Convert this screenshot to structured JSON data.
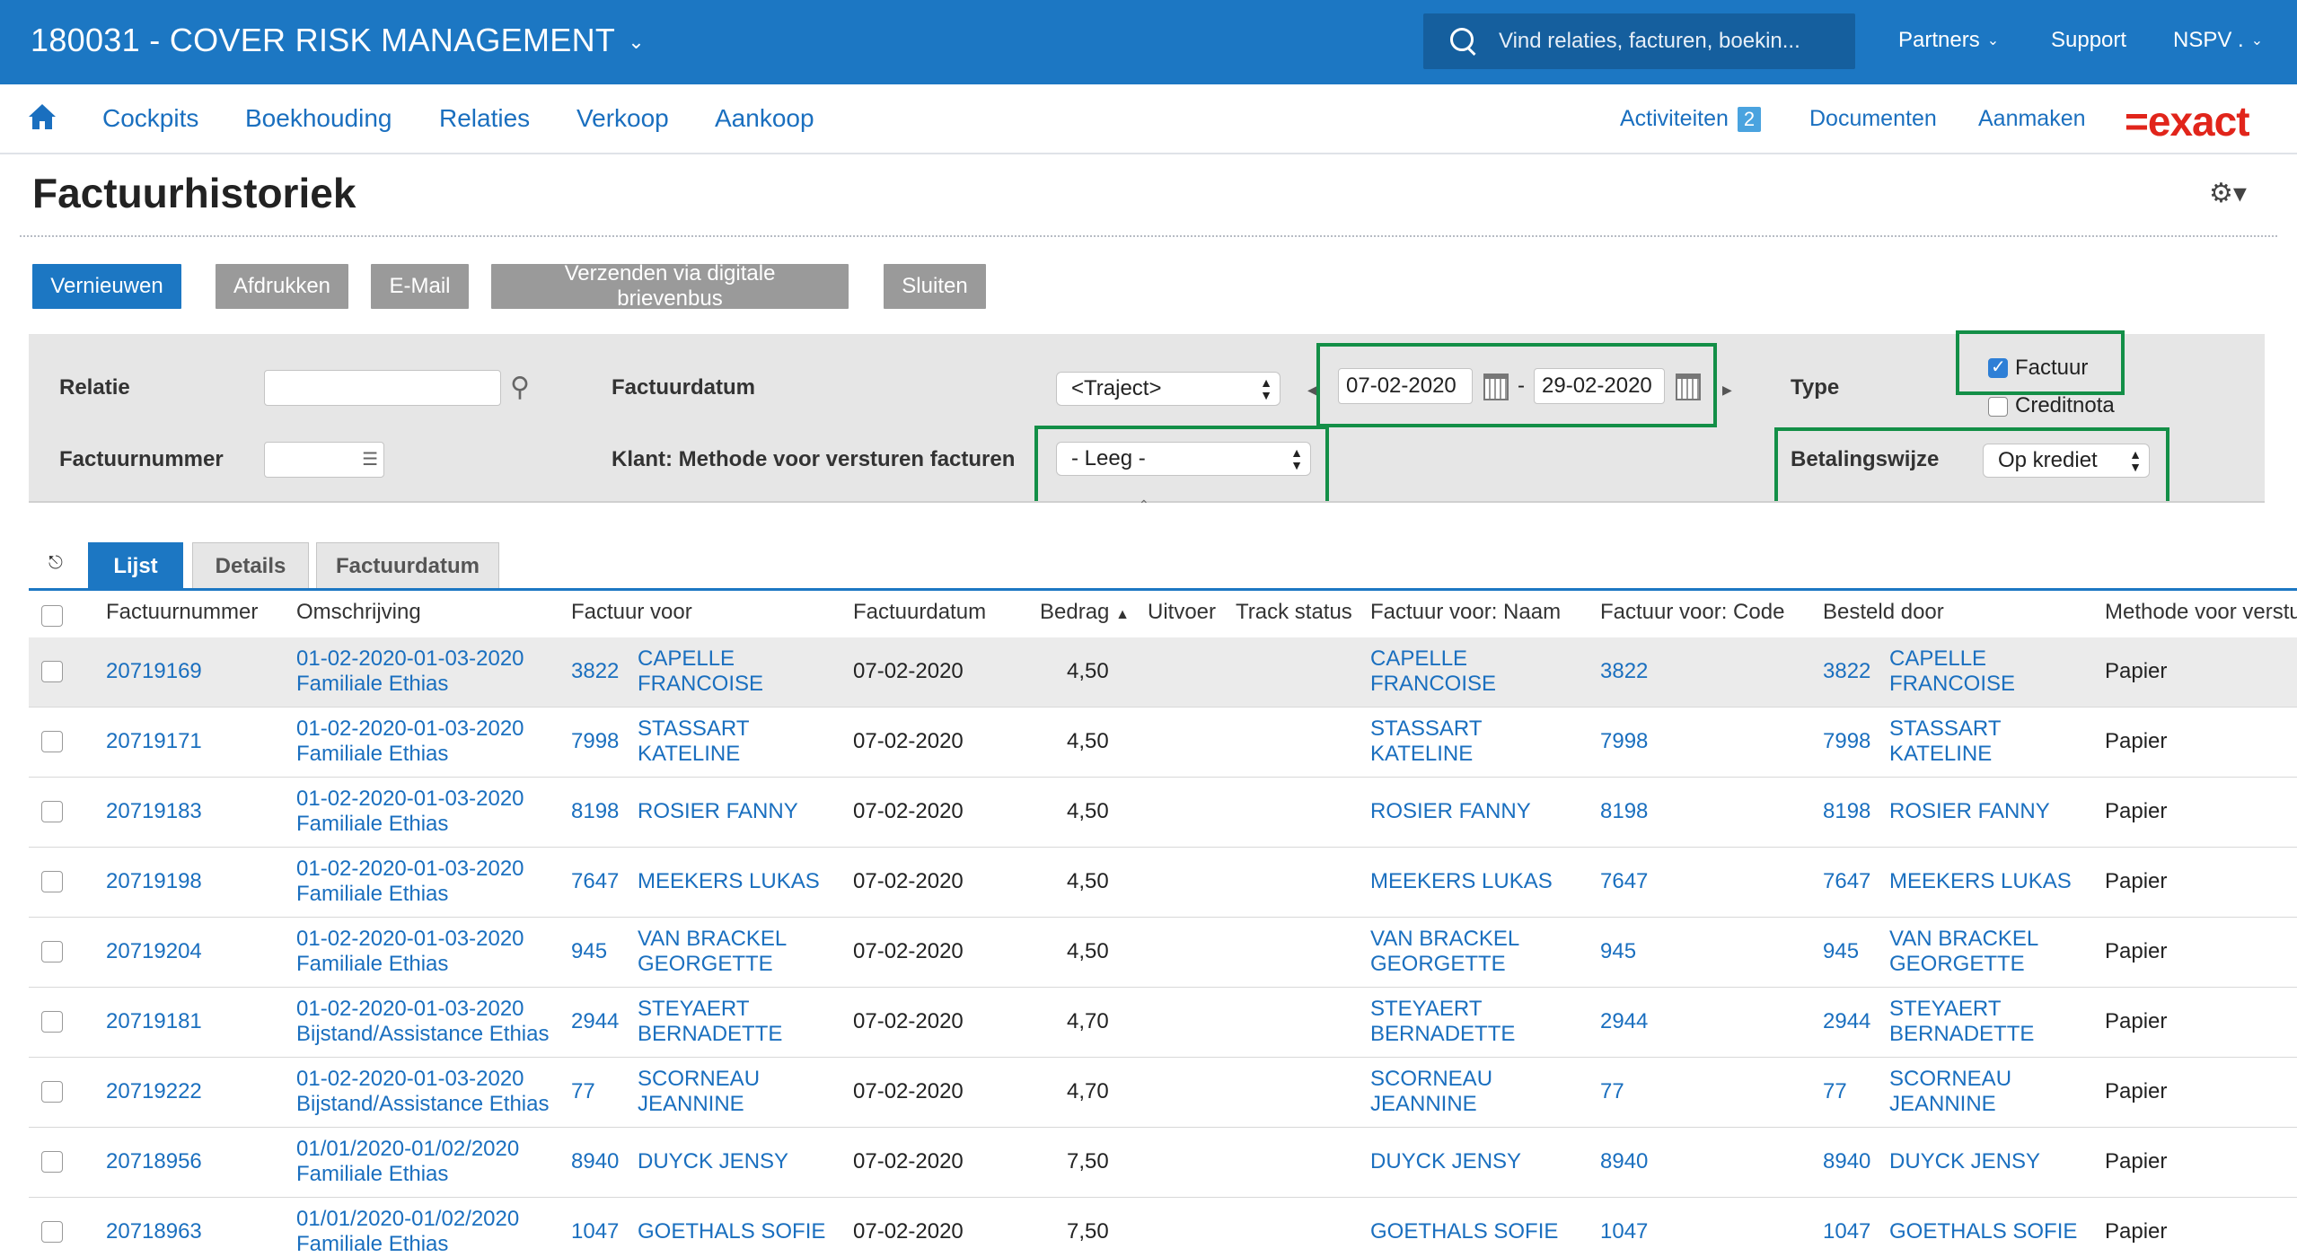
{
  "app": {
    "title": "180031 - COVER RISK MANAGEMENT",
    "search_placeholder": "Vind relaties, facturen, boekin...",
    "top_links": [
      "Partners",
      "Support",
      "NSPV ."
    ]
  },
  "menu": {
    "items": [
      "Cockpits",
      "Boekhouding",
      "Relaties",
      "Verkoop",
      "Aankoop"
    ],
    "activities_label": "Activiteiten",
    "activities_count": "2",
    "documents_label": "Documenten",
    "create_label": "Aanmaken",
    "logo_text": "=exact"
  },
  "page": {
    "title": "Factuurhistoriek"
  },
  "toolbar": {
    "buttons": [
      "Vernieuwen",
      "Afdrukken",
      "E-Mail",
      "Verzenden via digitale brievenbus",
      "Sluiten"
    ]
  },
  "filters": {
    "relatie_label": "Relatie",
    "factuurnummer_label": "Factuurnummer",
    "factuurdatum_label": "Factuurdatum",
    "traject_value": "<Traject>",
    "date_from": "07-02-2020",
    "date_sep": "-",
    "date_to": "29-02-2020",
    "methode_label": "Klant: Methode voor versturen facturen",
    "methode_value": "- Leeg -",
    "type_label": "Type",
    "type_factuur": "Factuur",
    "type_creditnota": "Creditnota",
    "betalingswijze_label": "Betalingswijze",
    "betalingswijze_value": "Op krediet"
  },
  "tabs": [
    "Lijst",
    "Details",
    "Factuurdatum"
  ],
  "table": {
    "headers": [
      "Factuurnummer",
      "Omschrijving",
      "Factuur voor",
      "Factuurdatum",
      "Bedrag",
      "Uitvoer",
      "Track status",
      "Factuur voor: Naam",
      "Factuur voor: Code",
      "Besteld door",
      "Methode voor verstu"
    ],
    "rows": [
      {
        "nr": "20719169",
        "desc1": "01-02-2020-01-03-2020",
        "desc2": "Familiale Ethias",
        "code": "3822",
        "name1": "CAPELLE",
        "name2": "FRANCOISE",
        "date": "07-02-2020",
        "amount": "4,50",
        "method": "Papier"
      },
      {
        "nr": "20719171",
        "desc1": "01-02-2020-01-03-2020",
        "desc2": "Familiale Ethias",
        "code": "7998",
        "name1": "STASSART",
        "name2": "KATELINE",
        "date": "07-02-2020",
        "amount": "4,50",
        "method": "Papier"
      },
      {
        "nr": "20719183",
        "desc1": "01-02-2020-01-03-2020",
        "desc2": "Familiale Ethias",
        "code": "8198",
        "name1": "ROSIER FANNY",
        "name2": "",
        "date": "07-02-2020",
        "amount": "4,50",
        "method": "Papier"
      },
      {
        "nr": "20719198",
        "desc1": "01-02-2020-01-03-2020",
        "desc2": "Familiale Ethias",
        "code": "7647",
        "name1": "MEEKERS LUKAS",
        "name2": "",
        "date": "07-02-2020",
        "amount": "4,50",
        "method": "Papier"
      },
      {
        "nr": "20719204",
        "desc1": "01-02-2020-01-03-2020",
        "desc2": "Familiale Ethias",
        "code": "945",
        "name1": "VAN BRACKEL",
        "name2": "GEORGETTE",
        "date": "07-02-2020",
        "amount": "4,50",
        "method": "Papier"
      },
      {
        "nr": "20719181",
        "desc1": "01-02-2020-01-03-2020",
        "desc2": "Bijstand/Assistance Ethias",
        "code": "2944",
        "name1": "STEYAERT",
        "name2": "BERNADETTE",
        "date": "07-02-2020",
        "amount": "4,70",
        "method": "Papier"
      },
      {
        "nr": "20719222",
        "desc1": "01-02-2020-01-03-2020",
        "desc2": "Bijstand/Assistance Ethias",
        "code": "77",
        "name1": "SCORNEAU",
        "name2": "JEANNINE",
        "date": "07-02-2020",
        "amount": "4,70",
        "method": "Papier"
      },
      {
        "nr": "20718956",
        "desc1": "01/01/2020-01/02/2020",
        "desc2": "Familiale Ethias",
        "code": "8940",
        "name1": "DUYCK JENSY",
        "name2": "",
        "date": "07-02-2020",
        "amount": "7,50",
        "method": "Papier"
      },
      {
        "nr": "20718963",
        "desc1": "01/01/2020-01/02/2020",
        "desc2": "Familiale Ethias",
        "code": "1047",
        "name1": "GOETHALS SOFIE",
        "name2": "",
        "date": "07-02-2020",
        "amount": "7,50",
        "method": "Papier"
      }
    ]
  },
  "colors": {
    "brand_blue": "#1c77c3",
    "link_blue": "#1a6fbf",
    "highlight_green": "#138f47",
    "logo_red": "#e1251b"
  }
}
